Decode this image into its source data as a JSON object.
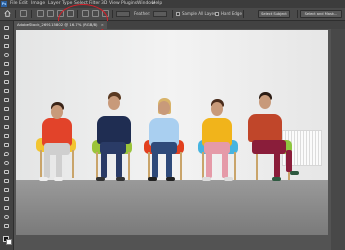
{
  "app": {
    "logo_text": "Ps"
  },
  "menubar": {
    "items": [
      "File",
      "Edit",
      "Image",
      "Layer",
      "Type",
      "Select",
      "Filter",
      "3D",
      "View",
      "Plugins",
      "Window",
      "Help"
    ]
  },
  "options": {
    "feather_label": "Feather:",
    "sample_all_layers_label": "Sample All Layers",
    "hard_edge_label": "Hard Edge",
    "select_subject_label": "Select Subject",
    "select_and_mask_label": "Select and Mask..."
  },
  "document": {
    "tab_title": "AdobeStock_269115802",
    "tab_zoom_info": "@ 16.7% (RGB/8)",
    "close_glyph": "×"
  },
  "colors": {
    "highlight_circle": "#d4202a",
    "panel_bg": "#535353",
    "toolbar_bg": "#424242"
  },
  "toolbar": {
    "tools": [
      "move",
      "artboard",
      "marquee",
      "lasso",
      "object-select",
      "crop",
      "frame",
      "eyedropper",
      "spot-heal",
      "brush",
      "clone-stamp",
      "history-brush",
      "eraser",
      "gradient",
      "blur",
      "dodge",
      "pen",
      "type",
      "path-select",
      "rectangle",
      "hand",
      "zoom",
      "more"
    ]
  }
}
